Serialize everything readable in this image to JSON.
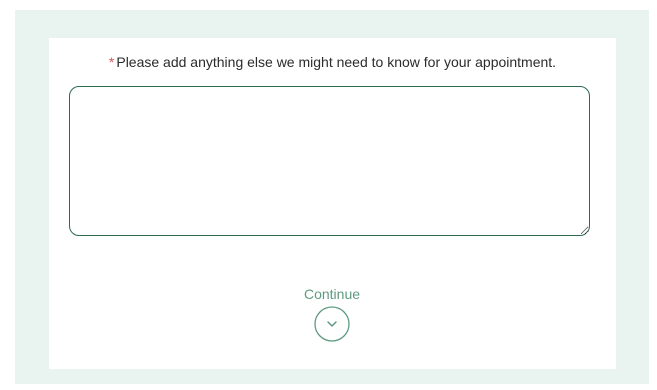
{
  "form": {
    "required_mark": "*",
    "question": "Please add anything else we might need to know for your appointment.",
    "answer_value": ""
  },
  "actions": {
    "continue_label": "Continue",
    "continue_icon": "chevron-down-circle-icon"
  },
  "colors": {
    "page_background": "#e9f3ef",
    "card_background": "#ffffff",
    "accent": "#5f9a80",
    "border": "#2d6b4e",
    "required": "#d9534f"
  }
}
